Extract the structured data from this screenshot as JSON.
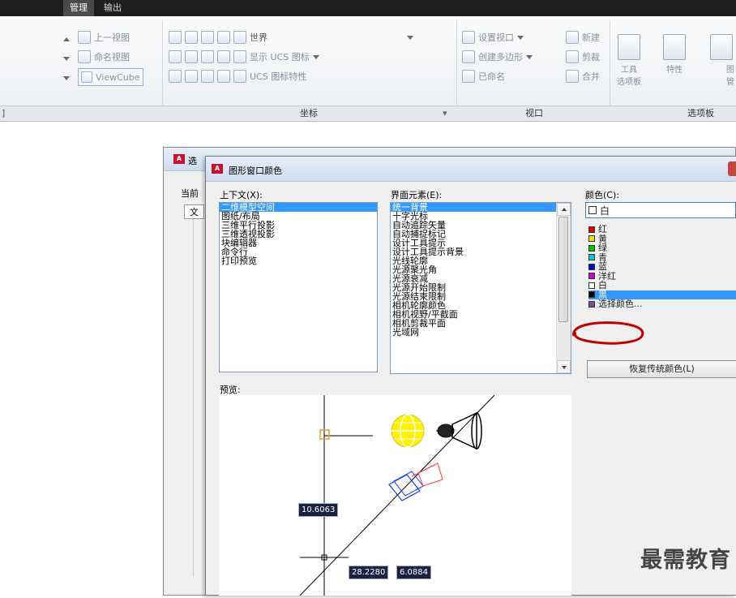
{
  "ribbon": {
    "top_tabs": [
      "",
      "管理",
      "输出"
    ],
    "view_group": {
      "prev_view": "上一视图",
      "named_view": "命名视图",
      "viewcube": "ViewCube"
    },
    "coords_group": {
      "world": "世界",
      "show_ucs_icon": "显示 UCS 图标",
      "ucs_icon_props": "UCS 图标特性"
    },
    "viewport_group": {
      "set_viewport": "设置视口",
      "create_polygon": "创建多边形",
      "named": "已命名",
      "new": "新建",
      "clip": "剪裁",
      "merge": "合并"
    },
    "palettes_group": {
      "tool_palettes_line1": "工具",
      "tool_palettes_line2": "选项板",
      "properties": "特性",
      "sheet_line1": "图",
      "sheet_line2": "管"
    },
    "panel_titles": {
      "coords": "坐标",
      "viewport": "视口",
      "palettes": "选项板"
    }
  },
  "outer_dialog": {
    "title_fragment": "选",
    "current_fragment": "当前",
    "tab_fragment": "文"
  },
  "color_dialog": {
    "title": "图形窗口颜色",
    "context_label": "上下文(X):",
    "context_items": [
      "二维模型空间",
      "图纸/布局",
      "三维平行投影",
      "三维透视投影",
      "块编辑器",
      "命令行",
      "打印预览"
    ],
    "context_selected": 0,
    "element_label": "界面元素(E):",
    "element_items": [
      "统一背景",
      "十字光标",
      "自动追踪矢量",
      "自动捕捉标记",
      "设计工具提示",
      "设计工具提示背景",
      "光线轮廓",
      "光源聚光角",
      "光源衰减",
      "光源开始限制",
      "光源结束限制",
      "相机轮廓颜色",
      "相机视野/平截面",
      "相机剪裁平面",
      "光域网"
    ],
    "element_selected": 0,
    "color_label": "颜色(C):",
    "color_dropdown_value": "白",
    "color_items": [
      {
        "label": "红",
        "swatch": "#e00000"
      },
      {
        "label": "黄",
        "swatch": "#f2e600"
      },
      {
        "label": "绿",
        "swatch": "#00c000"
      },
      {
        "label": "青",
        "swatch": "#00c8d8"
      },
      {
        "label": "蓝",
        "swatch": "#0010d0"
      },
      {
        "label": "洋红",
        "swatch": "#d000d0"
      },
      {
        "label": "白",
        "swatch": "#ffffff"
      },
      {
        "label": "黑",
        "swatch": "#000000"
      },
      {
        "label": "选择颜色...",
        "swatch": "#7a4a9a"
      }
    ],
    "color_selected": 7,
    "restore_button": "恢复传统颜色(L)",
    "preview_label": "预览:",
    "preview_coords": {
      "y": "10.6063",
      "x1": "28.2280",
      "x2": "6.0884"
    },
    "highlight_color": "#c00000",
    "selection_color": "#3399ff"
  },
  "watermark": "最需教育"
}
